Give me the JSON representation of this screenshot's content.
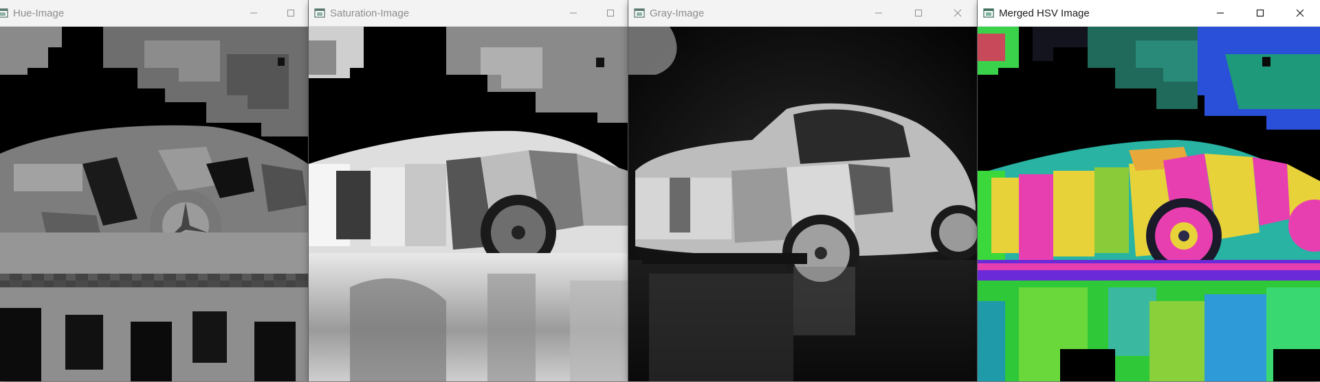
{
  "windows": [
    {
      "title": "Hue-Image"
    },
    {
      "title": "Saturation-Image"
    },
    {
      "title": "Gray-Image"
    },
    {
      "title": "Merged HSV Image"
    }
  ],
  "colors": {
    "titlebar_inactive": "#f3f3f3",
    "titlebar_active": "#ffffff",
    "title_text_inactive": "#8c8c8c",
    "title_text_active": "#1a1a1a",
    "hsv_yellow": "#e8d23a",
    "hsv_magenta": "#e83fb0",
    "hsv_green": "#3cd83a",
    "hsv_blue": "#2a4fd8"
  },
  "icons": [
    "app-window-icon",
    "minimize-icon",
    "maximize-icon",
    "close-icon"
  ]
}
